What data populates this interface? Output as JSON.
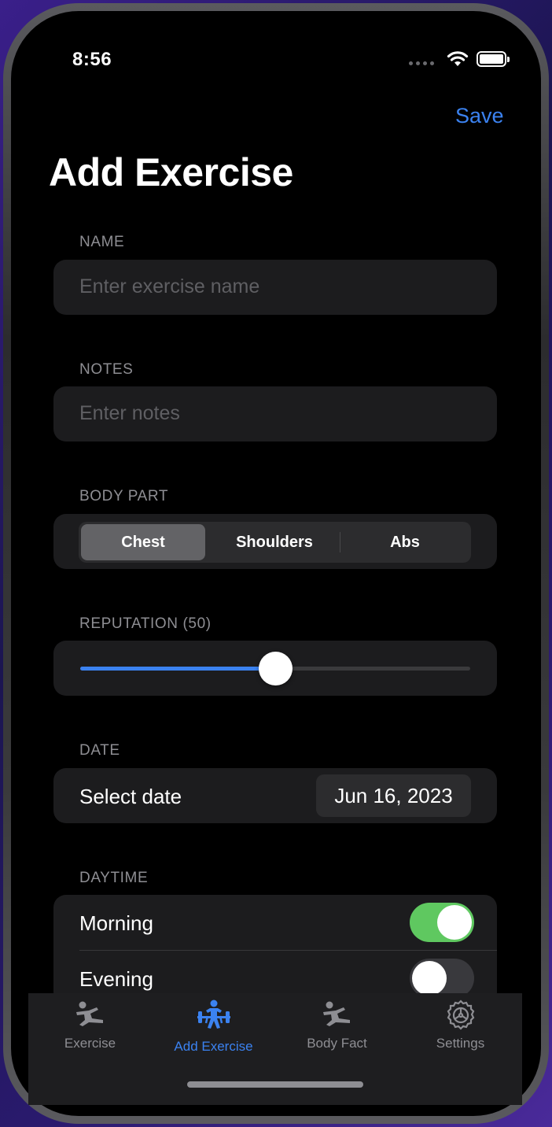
{
  "status": {
    "time": "8:56"
  },
  "header": {
    "save_label": "Save",
    "title": "Add Exercise"
  },
  "form": {
    "name": {
      "label": "NAME",
      "placeholder": "Enter exercise name",
      "value": ""
    },
    "notes": {
      "label": "NOTES",
      "placeholder": "Enter notes",
      "value": ""
    },
    "body_part": {
      "label": "BODY PART",
      "options": [
        "Chest",
        "Shoulders",
        "Abs"
      ],
      "selected": "Chest"
    },
    "reputation": {
      "label": "REPUTATION (50)",
      "value": 50,
      "min": 0,
      "max": 100
    },
    "date": {
      "label": "DATE",
      "row_label": "Select date",
      "value": "Jun 16, 2023"
    },
    "daytime": {
      "label": "DAYTIME",
      "items": [
        {
          "label": "Morning",
          "on": true
        },
        {
          "label": "Evening",
          "on": false
        }
      ]
    }
  },
  "tabbar": {
    "items": [
      {
        "label": "Exercise",
        "icon": "exercise-icon",
        "active": false
      },
      {
        "label": "Add Exercise",
        "icon": "weightlifter-icon",
        "active": true
      },
      {
        "label": "Body Fact",
        "icon": "body-fact-icon",
        "active": false
      },
      {
        "label": "Settings",
        "icon": "gear-icon",
        "active": false
      }
    ]
  },
  "colors": {
    "accent": "#3b82f0",
    "toggle_on": "#5fc860",
    "toggle_off": "#39393d",
    "card": "#1c1c1e"
  }
}
